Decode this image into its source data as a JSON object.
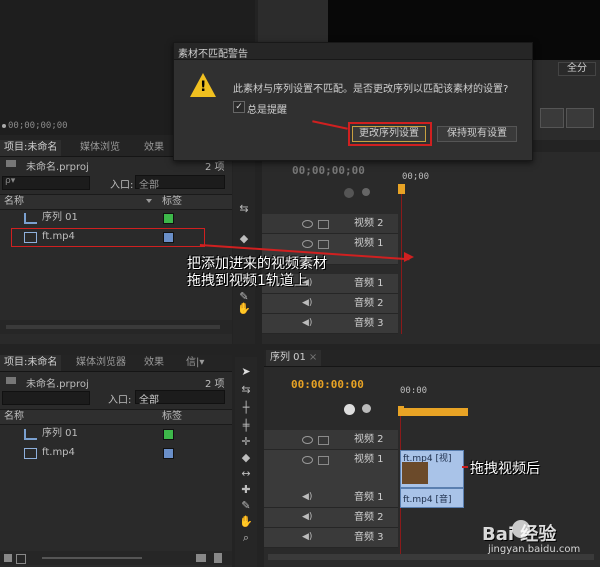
{
  "dialog": {
    "title": "素材不匹配警告",
    "message": "此素材与序列设置不匹配。是否更改序列以匹配该素材的设置?",
    "checkbox_label": "总是提醒",
    "checkbox_checked": true,
    "change_button": "更改序列设置",
    "keep_button": "保持现有设置"
  },
  "source_monitor": {
    "timecode": "00;00;00;00"
  },
  "program_monitor": {
    "fit_label": "全分"
  },
  "project_top": {
    "tabs": [
      "项目:未命名",
      "媒体浏览",
      "效果"
    ],
    "file_name": "未命名.prproj",
    "item_count": "2 项",
    "search_placeholder": "ρ▾",
    "in_label": "入口:",
    "in_value": "全部",
    "col_name": "名称",
    "col_label": "标签",
    "items": [
      {
        "name": "序列 01",
        "color": "#3db84a"
      },
      {
        "name": "ft.mp4",
        "color": "#6a8fc8"
      }
    ]
  },
  "project_bottom": {
    "tabs": [
      "项目:未命名",
      "媒体浏览器",
      "效果",
      "信|▾"
    ],
    "file_name": "未命名.prproj",
    "item_count": "2 项",
    "in_label": "入口:",
    "in_value": "全部",
    "col_name": "名称",
    "col_label": "标签",
    "items": [
      {
        "name": "序列 01",
        "color": "#3db84a"
      },
      {
        "name": "ft.mp4",
        "color": "#6a8fc8"
      }
    ]
  },
  "timeline_top": {
    "timecode": "00;00;00;00",
    "ruler_label": "00;00",
    "tracks": [
      "视频 2",
      "视频 1",
      "音频 1",
      "音频 2",
      "音频 3"
    ]
  },
  "timeline_bottom": {
    "tab": "序列 01",
    "timecode": "00:00:00:00",
    "ruler_label": "00:00",
    "tracks": [
      "视频 2",
      "视频 1",
      "音频 1",
      "音频 2",
      "音频 3"
    ],
    "video_clip": "ft.mp4 [视]",
    "audio_clip": "ft.mp4 [音]"
  },
  "annotations": {
    "drag_instruction_line1": "把添加进来的视频素材",
    "drag_instruction_line2": "拖拽到视频1轨道上",
    "after_drag": "拖拽视频后"
  },
  "watermark": {
    "brand": "Bai  经验",
    "url": "jingyan.baidu.com"
  },
  "colors": {
    "accent_orange": "#e8a325",
    "annotation_red": "#d02020",
    "clip_blue": "#a9c3e8"
  }
}
